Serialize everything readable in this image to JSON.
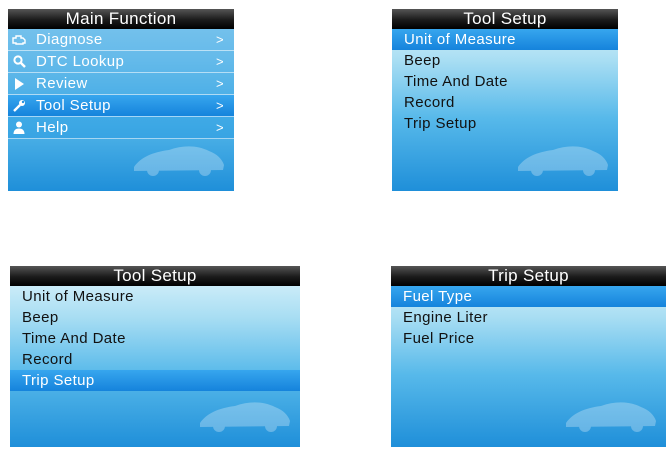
{
  "panels": {
    "main_function": {
      "title": "Main Function",
      "items": [
        {
          "label": "Diagnose",
          "arrow": ">",
          "icon": "engine-icon"
        },
        {
          "label": "DTC Lookup",
          "arrow": ">",
          "icon": "magnifier-icon"
        },
        {
          "label": "Review",
          "arrow": ">",
          "icon": "play-icon"
        },
        {
          "label": "Tool Setup",
          "arrow": ">",
          "icon": "wrench-icon",
          "selected": true
        },
        {
          "label": "Help",
          "arrow": ">",
          "icon": "person-icon"
        }
      ]
    },
    "tool_setup_1": {
      "title": "Tool Setup",
      "items": [
        "Unit of Measure",
        "Beep",
        "Time And Date",
        "Record",
        "Trip Setup"
      ],
      "selected": "Unit of Measure"
    },
    "tool_setup_2": {
      "title": "Tool Setup",
      "items": [
        "Unit of Measure",
        "Beep",
        "Time And Date",
        "Record",
        "Trip Setup"
      ],
      "selected": "Trip Setup"
    },
    "trip_setup": {
      "title": "Trip Setup",
      "items": [
        "Fuel Type",
        "Engine Liter",
        "Fuel Price"
      ],
      "selected": "Fuel Type"
    }
  },
  "colors": {
    "title_bar": "#111111",
    "selection": "#1f8fe0",
    "screen_bottom": "#1f8fd9"
  }
}
